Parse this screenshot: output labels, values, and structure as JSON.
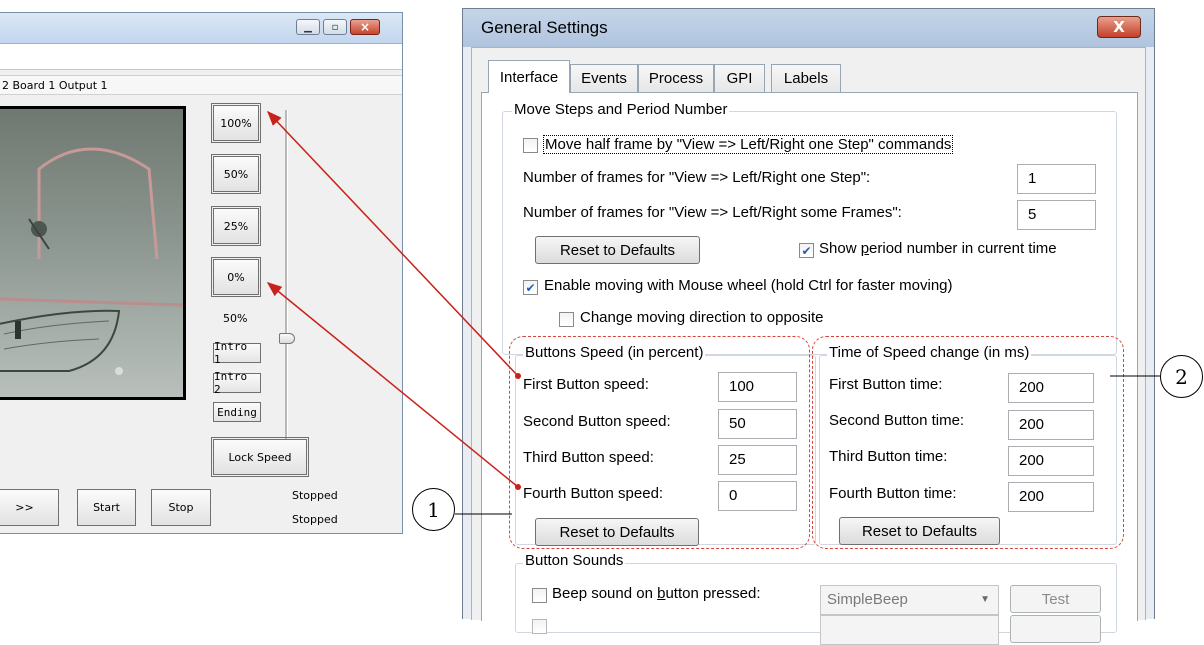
{
  "left_window": {
    "output_label": "2 Board 1 Output 1",
    "speed_buttons": [
      "100%",
      "50%",
      "25%",
      "0%"
    ],
    "slider_value": "50%",
    "intro_buttons": [
      "Intro 1",
      "Intro 2",
      "Ending"
    ],
    "lock_speed": "Lock Speed",
    "forward_button": ">>",
    "start_button": "Start",
    "stop_button": "Stop",
    "status_1": "Stopped",
    "status_2": "Stopped"
  },
  "dialog": {
    "title": "General Settings",
    "close_glyph": "X",
    "tabs": [
      "Interface",
      "Events",
      "Process",
      "GPI",
      "Labels"
    ],
    "move_group": {
      "title": "Move Steps and Period Number",
      "half_frame_label": "Move half frame by \"View => Left/Right one Step\" commands",
      "one_step_label": "Number of frames for \"View => Left/Right one Step\":",
      "one_step_value": "1",
      "some_frames_label": "Number of frames for \"View => Left/Right some Frames\":",
      "some_frames_value": "5",
      "reset_label": "Reset to Defaults",
      "show_period_pre": "Show ",
      "show_period_u": "p",
      "show_period_post": "eriod number in current time",
      "mouse_wheel_label": "Enable moving with Mouse wheel (hold Ctrl for faster moving)",
      "change_direction_label": "Change moving direction to opposite"
    },
    "speed_group": {
      "title": "Buttons Speed (in percent)",
      "rows": [
        {
          "label": "First Button speed:",
          "value": "100"
        },
        {
          "label": "Second Button speed:",
          "value": "50"
        },
        {
          "label": "Third Button speed:",
          "value": "25"
        },
        {
          "label": "Fourth Button speed:",
          "value": "0"
        }
      ],
      "reset_label": "Reset to Defaults"
    },
    "time_group": {
      "title": "Time of Speed change (in ms)",
      "rows": [
        {
          "label": "First Button time:",
          "value": "200"
        },
        {
          "label": "Second Button time:",
          "value": "200"
        },
        {
          "label": "Third Button time:",
          "value": "200"
        },
        {
          "label": "Fourth Button time:",
          "value": "200"
        }
      ],
      "reset_label": "Reset to Defaults"
    },
    "sounds_group": {
      "title": "Button Sounds",
      "beep_pre": "Beep sound on ",
      "beep_u": "b",
      "beep_post": "utton pressed:",
      "beep_combo": "SimpleBeep",
      "test_label": "Test"
    }
  },
  "callouts": [
    "1",
    "2"
  ],
  "colors": {
    "annotation_red": "#d9443a",
    "arrow_red": "#c8221a"
  }
}
